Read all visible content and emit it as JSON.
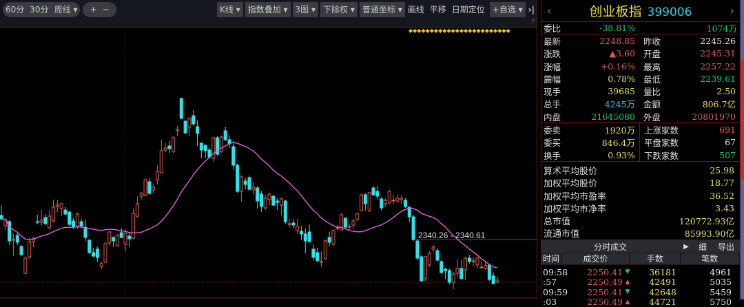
{
  "toolbar": {
    "left": [
      "60分",
      "30分",
      "周线 ▾"
    ],
    "zoom": [
      "+",
      "−"
    ],
    "right": [
      "K线 ▾",
      "指数叠加 ▾",
      "3图 ▾",
      "下除权 ▾",
      "普通坐标 ▾"
    ],
    "plain": [
      "画线",
      "平移",
      "日期定位"
    ],
    "fav": "+自选 ▾",
    "collapse": "›|",
    "help": "?"
  },
  "chart": {
    "range_label": "2340.26 - 2340.61",
    "colors": {
      "up": "#e0604f",
      "down": "#30e0e8",
      "ma": "#e060e0"
    }
  },
  "chart_data": {
    "type": "candlestick",
    "fields": [
      "open",
      "close",
      "high",
      "low"
    ],
    "ma_period": 20,
    "candles": [
      [
        2343,
        2338,
        2358,
        2336
      ],
      [
        2328,
        2337,
        2338,
        2322
      ],
      [
        2334,
        2306,
        2336,
        2300
      ],
      [
        2307,
        2308,
        2316,
        2284
      ],
      [
        2314,
        2304,
        2318,
        2300
      ],
      [
        2298,
        2286,
        2300,
        2284
      ],
      [
        2259,
        2281,
        2284,
        2258
      ],
      [
        2283,
        2305,
        2311,
        2280
      ],
      [
        2305,
        2310,
        2312,
        2297
      ],
      [
        2334,
        2333,
        2344,
        2330
      ],
      [
        2333,
        2336,
        2351,
        2328
      ],
      [
        2340,
        2331,
        2345,
        2329
      ],
      [
        2325,
        2342,
        2351,
        2323
      ],
      [
        2335,
        2355,
        2366,
        2333
      ],
      [
        2356,
        2358,
        2365,
        2348
      ],
      [
        2353,
        2360,
        2361,
        2342
      ],
      [
        2351,
        2345,
        2355,
        2343
      ],
      [
        2348,
        2330,
        2349,
        2328
      ],
      [
        2335,
        2326,
        2339,
        2323
      ],
      [
        2326,
        2345,
        2347,
        2323
      ],
      [
        2334,
        2328,
        2338,
        2324
      ],
      [
        2326,
        2311,
        2337,
        2306
      ],
      [
        2307,
        2289,
        2309,
        2287
      ],
      [
        2289,
        2284,
        2296,
        2282
      ],
      [
        2294,
        2282,
        2298,
        2275
      ],
      [
        2269,
        2273,
        2276,
        2265
      ],
      [
        2275,
        2302,
        2304,
        2274
      ],
      [
        2303,
        2319,
        2321,
        2299
      ],
      [
        2311,
        2306,
        2313,
        2297
      ],
      [
        2299,
        2314,
        2316,
        2298
      ],
      [
        2318,
        2311,
        2325,
        2310
      ],
      [
        2301,
        2317,
        2323,
        2291
      ],
      [
        2313,
        2309,
        2319,
        2297
      ],
      [
        2310,
        2346,
        2353,
        2309
      ],
      [
        2342,
        2360,
        2371,
        2340
      ],
      [
        2371,
        2375,
        2377,
        2366
      ],
      [
        2372,
        2395,
        2396,
        2371
      ],
      [
        2392,
        2375,
        2397,
        2373
      ],
      [
        2380,
        2384,
        2388,
        2376
      ],
      [
        2395,
        2407,
        2416,
        2388
      ],
      [
        2405,
        2437,
        2453,
        2404
      ],
      [
        2438,
        2441,
        2448,
        2435
      ],
      [
        2444,
        2440,
        2451,
        2434
      ],
      [
        2436,
        2456,
        2458,
        2433
      ],
      [
        2466,
        2468,
        2473,
        2458
      ],
      [
        2513,
        2484,
        2514,
        2483
      ],
      [
        2480,
        2463,
        2481,
        2461
      ],
      [
        2471,
        2484,
        2486,
        2458
      ],
      [
        2488,
        2476,
        2496,
        2473
      ],
      [
        2472,
        2462,
        2481,
        2444
      ],
      [
        2448,
        2438,
        2449,
        2426
      ],
      [
        2445,
        2437,
        2446,
        2426
      ],
      [
        2438,
        2428,
        2441,
        2425
      ],
      [
        2426,
        2456,
        2456,
        2421
      ],
      [
        2456,
        2432,
        2458,
        2430
      ],
      [
        2436,
        2457,
        2459,
        2434
      ],
      [
        2466,
        2453,
        2472,
        2451
      ],
      [
        2453,
        2447,
        2459,
        2441
      ],
      [
        2443,
        2416,
        2451,
        2409
      ],
      [
        2416,
        2378,
        2418,
        2376
      ],
      [
        2378,
        2399,
        2401,
        2363
      ],
      [
        2393,
        2388,
        2398,
        2381
      ],
      [
        2398,
        2381,
        2401,
        2379
      ],
      [
        2380,
        2384,
        2391,
        2373
      ],
      [
        2383,
        2364,
        2386,
        2353
      ],
      [
        2374,
        2356,
        2378,
        2348
      ],
      [
        2354,
        2368,
        2373,
        2351
      ],
      [
        2366,
        2374,
        2376,
        2358
      ],
      [
        2371,
        2358,
        2373,
        2356
      ],
      [
        2364,
        2362,
        2368,
        2351
      ],
      [
        2358,
        2367,
        2369,
        2343
      ],
      [
        2364,
        2334,
        2366,
        2331
      ],
      [
        2331,
        2331,
        2338,
        2326
      ],
      [
        2332,
        2329,
        2338,
        2325
      ],
      [
        2321,
        2327,
        2338,
        2316
      ],
      [
        2320,
        2316,
        2328,
        2308
      ],
      [
        2316,
        2306,
        2324,
        2288
      ],
      [
        2319,
        2305,
        2330,
        2304
      ],
      [
        2294,
        2282,
        2301,
        2278
      ],
      [
        2289,
        2277,
        2296,
        2276
      ],
      [
        2276,
        2276,
        2291,
        2268
      ],
      [
        2280,
        2306,
        2308,
        2279
      ],
      [
        2311,
        2304,
        2319,
        2298
      ],
      [
        2301,
        2321,
        2324,
        2299
      ],
      [
        2324,
        2325,
        2329,
        2322
      ],
      [
        2322,
        2344,
        2346,
        2321
      ],
      [
        2339,
        2326,
        2340,
        2324
      ],
      [
        2326,
        2327,
        2331,
        2321
      ],
      [
        2329,
        2335,
        2338,
        2323
      ],
      [
        2337,
        2346,
        2347,
        2335
      ],
      [
        2350,
        2373,
        2374,
        2349
      ],
      [
        2373,
        2360,
        2375,
        2350
      ],
      [
        2350,
        2376,
        2377,
        2348
      ],
      [
        2383,
        2373,
        2386,
        2371
      ],
      [
        2378,
        2371,
        2386,
        2366
      ],
      [
        2367,
        2354,
        2370,
        2350
      ],
      [
        2360,
        2365,
        2368,
        2356
      ],
      [
        2361,
        2378,
        2380,
        2360
      ],
      [
        2364,
        2365,
        2373,
        2359
      ],
      [
        2364,
        2368,
        2373,
        2361
      ],
      [
        2366,
        2368,
        2373,
        2360
      ],
      [
        2365,
        2356,
        2368,
        2354
      ],
      [
        2355,
        2341,
        2356,
        2333
      ],
      [
        2341,
        2308,
        2344,
        2306
      ],
      [
        2306,
        2281,
        2308,
        2278
      ],
      [
        2283,
        2248,
        2285,
        2246
      ],
      [
        2251,
        2283,
        2284,
        2248
      ],
      [
        2271,
        2288,
        2291,
        2268
      ],
      [
        2294,
        2297,
        2300,
        2290
      ],
      [
        2292,
        2278,
        2296,
        2276
      ],
      [
        2276,
        2260,
        2278,
        2258
      ],
      [
        2265,
        2263,
        2267,
        2251
      ],
      [
        2263,
        2246,
        2266,
        2243
      ],
      [
        2246,
        2258,
        2261,
        2236
      ],
      [
        2259,
        2266,
        2279,
        2254
      ],
      [
        2266,
        2251,
        2278,
        2250
      ],
      [
        2264,
        2281,
        2283,
        2249
      ],
      [
        2281,
        2276,
        2286,
        2273
      ],
      [
        2276,
        2277,
        2282,
        2270
      ],
      [
        2271,
        2281,
        2283,
        2266
      ],
      [
        2268,
        2268,
        2276,
        2266
      ],
      [
        2266,
        2270,
        2276,
        2264
      ],
      [
        2271,
        2250,
        2273,
        2248
      ],
      [
        2255,
        2244,
        2260,
        2243
      ],
      [
        2246,
        2249,
        2254,
        2244
      ]
    ],
    "ylim": [
      2221,
      2656
    ]
  },
  "panel": {
    "name": "创业板指",
    "code": "399006",
    "prev": "‹",
    "next": "›",
    "weibi": {
      "label": "委比",
      "pct": "-38.81%",
      "vol": "1074万"
    },
    "quote": [
      {
        "l1": "最新",
        "v1": "2248.85",
        "k1": "red",
        "l2": "昨收",
        "v2": "2245.26",
        "k2": "wht"
      },
      {
        "l1": "涨跌",
        "v1": "▲3.60",
        "k1": "red",
        "l2": "开盘",
        "v2": "2245.31",
        "k2": "red"
      },
      {
        "l1": "涨幅",
        "v1": "+0.16%",
        "k1": "red",
        "l2": "最高",
        "v2": "2257.22",
        "k2": "red"
      },
      {
        "l1": "震幅",
        "v1": "0.78%",
        "k1": "yel",
        "l2": "最低",
        "v2": "2239.61",
        "k2": "grn"
      },
      {
        "l1": "现手",
        "v1": "39685",
        "k1": "yel",
        "l2": "量比",
        "v2": "2.50",
        "k2": "yel"
      },
      {
        "l1": "总手",
        "v1": "4245万",
        "k1": "cya",
        "l2": "金额",
        "v2": "806.7亿",
        "k2": "yel"
      },
      {
        "l1": "内盘",
        "v1": "21645080",
        "k1": "grn",
        "l2": "外盘",
        "v2": "20801970",
        "k2": "red"
      }
    ],
    "orders": [
      {
        "l1": "委卖",
        "v1": "1920万",
        "k1": "yel",
        "l2": "上涨家数",
        "v2": "691",
        "k2": "red"
      },
      {
        "l1": "委买",
        "v1": "846.4万",
        "k1": "yel",
        "l2": "平盘家数",
        "v2": "67",
        "k2": "wht"
      },
      {
        "l1": "换手",
        "v1": "0.93%",
        "k1": "yel",
        "l2": "下跌家数",
        "v2": "507",
        "k2": "grn"
      }
    ],
    "stats": [
      {
        "label": "算术平均股价",
        "value": "25.98"
      },
      {
        "label": "加权平均股价",
        "value": "18.77"
      },
      {
        "label": "加权平均市盈率",
        "value": "36.52"
      },
      {
        "label": "加权平均市净率",
        "value": "3.43"
      },
      {
        "label": "总市值",
        "value": "120772.93亿"
      },
      {
        "label": "流通市值",
        "value": "85993.90亿"
      }
    ],
    "ticks": {
      "title": "分时成交",
      "play": "▶",
      "detail": "细",
      "export": "导出",
      "headers": [
        "时间",
        "成交价",
        "手数",
        "笔数"
      ],
      "rows": [
        {
          "time": "09:58",
          "price": "2250.41",
          "dir": "▼",
          "hands": "36181",
          "count": "4961"
        },
        {
          "time": ":57",
          "price": "2250.49",
          "dir": "▲",
          "hands": "42491",
          "count": "5035"
        },
        {
          "time": "09:59",
          "price": "2250.41",
          "dir": "▼",
          "hands": "42648",
          "count": "5459"
        },
        {
          "time": ":03",
          "price": "2250.49",
          "dir": "▲",
          "hands": "44721",
          "count": "5750"
        }
      ]
    }
  }
}
